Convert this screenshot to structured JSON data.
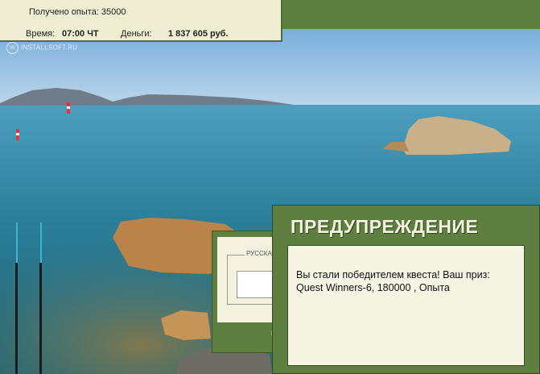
{
  "hud": {
    "experience_text": "Получено опыта: 35000",
    "time_label": "Время:",
    "time_value": "07:00 ЧТ",
    "money_label": "Деньги:",
    "money_value": "1 837 605 руб."
  },
  "watermark": "INSTALLSOFT.RU",
  "background_dialog": {
    "tab_label": "РУССКАЯ",
    "fragment": "П"
  },
  "warning_dialog": {
    "title": "ПРЕДУПРЕЖДЕНИЕ",
    "message": "Вы стали победителем квеста! Ваш приз: Quest Winners-6, 180000 , Опыта"
  },
  "colors": {
    "panel_green": "#5e7f3f",
    "panel_cream": "#efedd2",
    "sea_blue": "#2f7fa7"
  }
}
